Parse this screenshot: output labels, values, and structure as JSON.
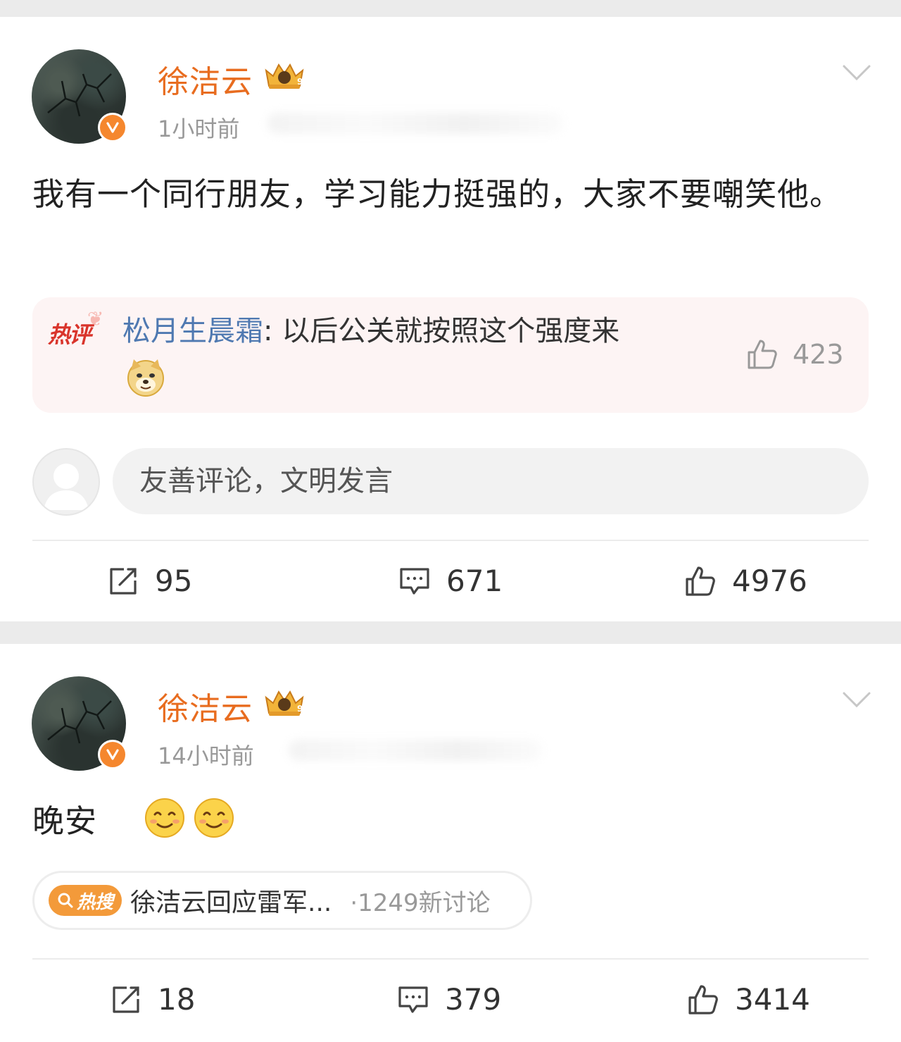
{
  "posts": [
    {
      "username": "徐洁云",
      "timestamp": "1小时前",
      "text": "我有一个同行朋友，学习能力挺强的，大家不要嘲笑他。",
      "hot_comment": {
        "tag": "热评",
        "user": "松月生晨霜",
        "separator": ":",
        "text": " 以后公关就按照这个强度来",
        "likes": "423"
      },
      "comment_placeholder": "友善评论，文明发言",
      "actions": {
        "reposts": "95",
        "comments": "671",
        "likes": "4976"
      }
    },
    {
      "username": "徐洁云",
      "timestamp": "14小时前",
      "text": "晚安",
      "topic": {
        "badge": "热搜",
        "title": "徐洁云回应雷军...",
        "count": "·1249新讨论"
      },
      "actions": {
        "reposts": "18",
        "comments": "379",
        "likes": "3414"
      }
    }
  ],
  "colors": {
    "username": "#e86c1f",
    "verified_badge": "#f5872e",
    "hot_tag": "#d9342b",
    "comment_user": "#4f79b1",
    "topic_badge": "#f39a3a"
  },
  "icons": [
    "chevron-down-icon",
    "crown-icon",
    "verified-icon",
    "thumb-up-icon",
    "repost-icon",
    "comment-icon",
    "search-icon",
    "doge-emoji",
    "smile-emoji"
  ]
}
